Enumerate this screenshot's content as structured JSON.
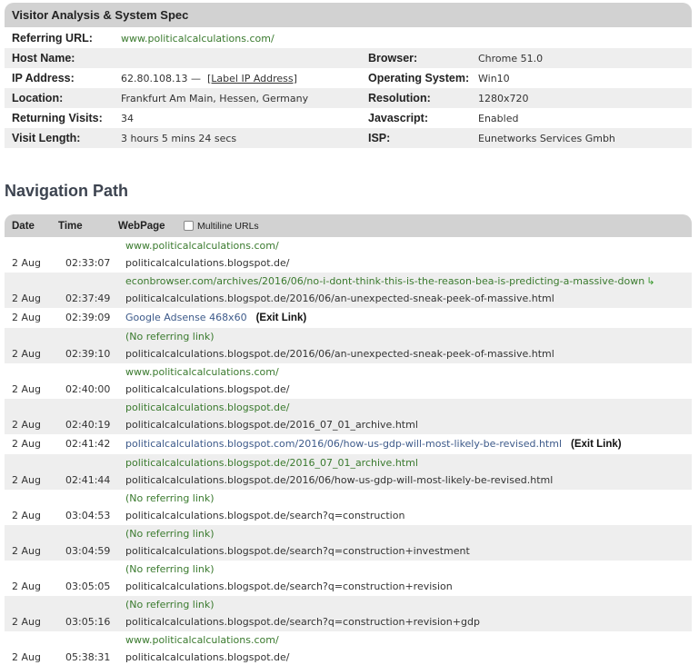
{
  "visitor": {
    "title": "Visitor Analysis & System Spec",
    "referring_url_label": "Referring URL:",
    "referring_url": "www.politicalcalculations.com/",
    "host_name_label": "Host Name:",
    "host_name": "",
    "browser_label": "Browser:",
    "browser": "Chrome 51.0",
    "ip_label": "IP Address:",
    "ip": "62.80.108.13 —",
    "ip_link": "[Label IP Address]",
    "os_label": "Operating System:",
    "os": "Win10",
    "location_label": "Location:",
    "location": "Frankfurt Am Main, Hessen, Germany",
    "resolution_label": "Resolution:",
    "resolution": "1280x720",
    "returning_label": "Returning Visits:",
    "returning": "34",
    "javascript_label": "Javascript:",
    "javascript": "Enabled",
    "visit_length_label": "Visit Length:",
    "visit_length": "3 hours 5 mins 24 secs",
    "isp_label": "ISP:",
    "isp": "Eunetworks Services Gmbh"
  },
  "nav": {
    "title": "Navigation Path",
    "col_date": "Date",
    "col_time": "Time",
    "col_page": "WebPage",
    "multiline_label": "Multiline URLs",
    "exit_label": "(Exit Link)",
    "rows": [
      {
        "date": "2 Aug",
        "time": "02:33:07",
        "ref": "www.politicalcalculations.com/",
        "page": "politicalcalculations.blogspot.de/"
      },
      {
        "date": "2 Aug",
        "time": "02:37:49",
        "ref": "econbrowser.com/archives/2016/06/no-i-dont-think-this-is-the-reason-bea-is-predicting-a-massive-down",
        "page": "politicalcalculations.blogspot.de/2016/06/an-unexpected-sneak-peek-of-massive.html"
      },
      {
        "date": "2 Aug",
        "time": "02:39:09",
        "page": "Google Adsense 468x60"
      },
      {
        "date": "2 Aug",
        "time": "02:39:10",
        "ref": "(No referring link)",
        "page": "politicalcalculations.blogspot.de/2016/06/an-unexpected-sneak-peek-of-massive.html"
      },
      {
        "date": "2 Aug",
        "time": "02:40:00",
        "ref": "www.politicalcalculations.com/",
        "page": "politicalcalculations.blogspot.de/"
      },
      {
        "date": "2 Aug",
        "time": "02:40:19",
        "ref": "politicalcalculations.blogspot.de/",
        "page": "politicalcalculations.blogspot.de/2016_07_01_archive.html"
      },
      {
        "date": "2 Aug",
        "time": "02:41:42",
        "page": "politicalcalculations.blogspot.com/2016/06/how-us-gdp-will-most-likely-be-revised.html"
      },
      {
        "date": "2 Aug",
        "time": "02:41:44",
        "ref": "politicalcalculations.blogspot.de/2016_07_01_archive.html",
        "page": "politicalcalculations.blogspot.de/2016/06/how-us-gdp-will-most-likely-be-revised.html"
      },
      {
        "date": "2 Aug",
        "time": "03:04:53",
        "ref": "(No referring link)",
        "page": "politicalcalculations.blogspot.de/search?q=construction"
      },
      {
        "date": "2 Aug",
        "time": "03:04:59",
        "ref": "(No referring link)",
        "page": "politicalcalculations.blogspot.de/search?q=construction+investment"
      },
      {
        "date": "2 Aug",
        "time": "03:05:05",
        "ref": "(No referring link)",
        "page": "politicalcalculations.blogspot.de/search?q=construction+revision"
      },
      {
        "date": "2 Aug",
        "time": "03:05:16",
        "ref": "(No referring link)",
        "page": "politicalcalculations.blogspot.de/search?q=construction+revision+gdp"
      },
      {
        "date": "2 Aug",
        "time": "05:38:31",
        "ref": "www.politicalcalculations.com/",
        "page": "politicalcalculations.blogspot.de/"
      }
    ]
  }
}
